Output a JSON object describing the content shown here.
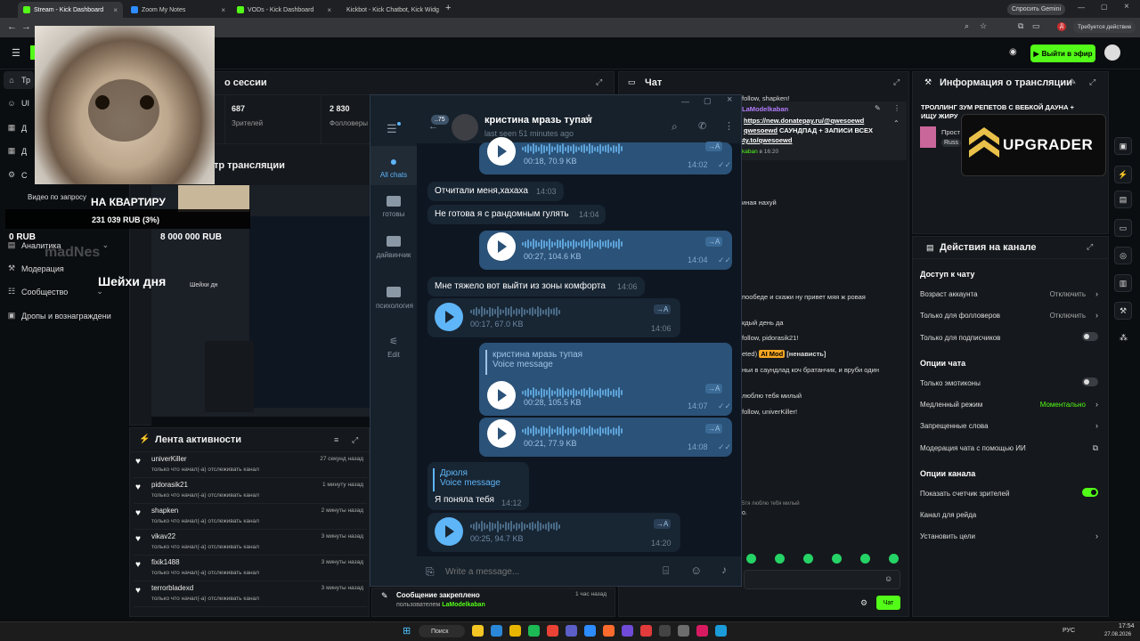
{
  "browser": {
    "tabs": [
      {
        "label": "Stream - Kick Dashboard",
        "active": true,
        "color": "#53fc18"
      },
      {
        "label": "Zoom My Notes",
        "active": false,
        "color": "#2d8cff"
      },
      {
        "label": "VODs - Kick Dashboard",
        "active": false,
        "color": "#53fc18"
      },
      {
        "label": "Kickbot - Kick Chatbot, Kick Widg",
        "active": false,
        "color": "#53fc18"
      }
    ],
    "new_tab": "+",
    "gemini_label": "Спросить Gemini",
    "update_label": "Требуется действие"
  },
  "kick": {
    "go_live_label": "Выйти в эфир"
  },
  "sidebar": {
    "items": [
      {
        "label": "Тр",
        "icon": "home-icon"
      },
      {
        "label": "UI",
        "icon": "user-icon"
      },
      {
        "label": "Д",
        "icon": "grid-icon"
      },
      {
        "label": "Д",
        "icon": "grid-icon"
      },
      {
        "label": "С",
        "icon": "gear-icon"
      },
      {
        "label": "Аналитика",
        "icon": "chart-icon"
      },
      {
        "label": "Модерация",
        "icon": "hammer-icon"
      },
      {
        "label": "Сообщество",
        "icon": "users-icon"
      },
      {
        "label": "Дропы и вознаграждени",
        "icon": "gift-icon"
      }
    ],
    "video_request": "Видео по запросу"
  },
  "overlays": {
    "apartment": "НА КВАРТИРУ",
    "goal_progress": "231 039 RUB (3%)",
    "zero_rub": "0 RUB",
    "goal_target": "8 000 000 RUB",
    "streamer_name_ghost": "madNes",
    "pug_caption": "Шейхи дня",
    "pug_caption2": "Шейхи дн",
    "upgrader_label": "UPGRADER"
  },
  "session": {
    "title": "о сессии",
    "viewers_value": "687",
    "viewers_label": "Зрителей",
    "followers_value": "2 830",
    "followers_label": "Фолловеры",
    "preview_title": "тр трансляции"
  },
  "activity": {
    "title": "Лента активности",
    "subtitle_text": "только что начал(-а) отслеживать канал",
    "rows": [
      {
        "name": "univerKiller",
        "time": "27 секунд назад"
      },
      {
        "name": "pidorasik21",
        "time": "1 минуту назад"
      },
      {
        "name": "shapken",
        "time": "2 минуты назад"
      },
      {
        "name": "vikav22",
        "time": "3 минуты назад"
      },
      {
        "name": "fixik1488",
        "time": "3 минуты назад"
      },
      {
        "name": "terrorbladexd",
        "time": "3 минуты назад"
      }
    ]
  },
  "pinned": {
    "title": "Сообщение закреплено",
    "time": "1 час назад",
    "by_label": "пользователем",
    "by_user": "LaModelkaban"
  },
  "chat": {
    "title": "Чат",
    "top_line": "follow, shapken!",
    "pinned_user": "LaModelkaban",
    "pinned_link1": "https://new.donatepay.ru/@qwesoewd",
    "pinned_link2": "qwesoewd",
    "pinned_text": "САУНДПАД + ЗАПИСИ ВСЕХ",
    "pinned_link3": "sty.to/qwesoewd",
    "pinned_time_user": "kaban",
    "pinned_time": "в 16:20",
    "lines": [
      "иная нахуй",
      "пообеде и скажи ну привет мяя ж ровая",
      "кдый день да",
      "follow, pidorasik21!",
      "eted)",
      "ньи в саундлад коч братанчик, и вруби один",
      "люблю тебя милый",
      "follow, univerKiller!",
      "5тя люблю тебя милый",
      "о."
    ],
    "mod_badge": "AI Mod",
    "mod_word": "[ненависть]",
    "send_label": "Чат"
  },
  "stream_info": {
    "title": "Информация о трансляции",
    "stream_title": "ТРОЛЛИНГ ЗУМ РЕПЕТОВ С ВЕБКОЙ ДАУНА + ИЩУ ЖИРУ",
    "category": "Прост",
    "lang": "Russ"
  },
  "actions": {
    "title": "Действия на канале",
    "chat_access": "Доступ к чату",
    "account_age_label": "Возраст аккаунта",
    "account_age_value": "Отключить",
    "followers_only_label": "Только для фолловеров",
    "followers_only_value": "Отключить",
    "subs_only_label": "Только для подписчиков",
    "chat_options": "Опции чата",
    "emotes_only_label": "Только эмотиконы",
    "slow_mode_label": "Медленный режим",
    "slow_mode_value": "Моментально",
    "banned_words_label": "Запрещенные слова",
    "ai_mod_label": "Модерация чата с помощью ИИ",
    "channel_options": "Опции канала",
    "show_viewers_label": "Показать счетчик зрителей",
    "raid_label": "Канал для рейда",
    "goals_label": "Установить цели",
    "subs_only_on": false,
    "emotes_only_on": false,
    "show_viewers_on": true
  },
  "telegram": {
    "unread_badge": "75",
    "chat_name": "кристина мразь тупая",
    "last_seen": "last seen 51 minutes ago",
    "folders": [
      {
        "label": "All chats",
        "active": true
      },
      {
        "label": "готовы",
        "active": false
      },
      {
        "label": "дайвинчик",
        "active": false
      },
      {
        "label": "психология",
        "active": false
      },
      {
        "label": "Edit",
        "active": false
      }
    ],
    "messages": {
      "v1_meta": "00:18, 70.9 KB",
      "v1_time": "14:02",
      "t1": "Отчитали меня,хахаха",
      "t1_time": "14:03",
      "t2": "Не готова я с рандомным гулять",
      "t2_time": "14:04",
      "v2_meta": "00:27, 104.6 KB",
      "v2_time": "14:04",
      "t3": "Мне тяжело вот выйти из зоны комфорта",
      "t3_time": "14:06",
      "v3_meta": "00:17, 67.0 KB",
      "v3_time": "14:06",
      "reply1_name": "кристина мразь тупая",
      "reply1_text": "Voice message",
      "v4_meta": "00:28, 105.5 KB",
      "v4_time": "14:07",
      "v5_meta": "00:21, 77.9 KB",
      "v5_time": "14:08",
      "reply2_name": "Дрюля",
      "reply2_text": "Voice message",
      "t4": "Я поняла тебя",
      "t4_time": "14:12",
      "v6_meta": "00:25, 94.7 KB",
      "v6_time": "14:20"
    },
    "transcribe_label": "→A",
    "input_placeholder": "Write a message..."
  },
  "taskbar": {
    "search_label": "Поиск",
    "lang": "РУС",
    "time": "17:54",
    "date": "27.08.2026"
  },
  "colors": {
    "kick_green": "#53fc18",
    "tg_bg": "#0e1621",
    "tg_out": "#2b5278",
    "tg_in": "#182533"
  }
}
